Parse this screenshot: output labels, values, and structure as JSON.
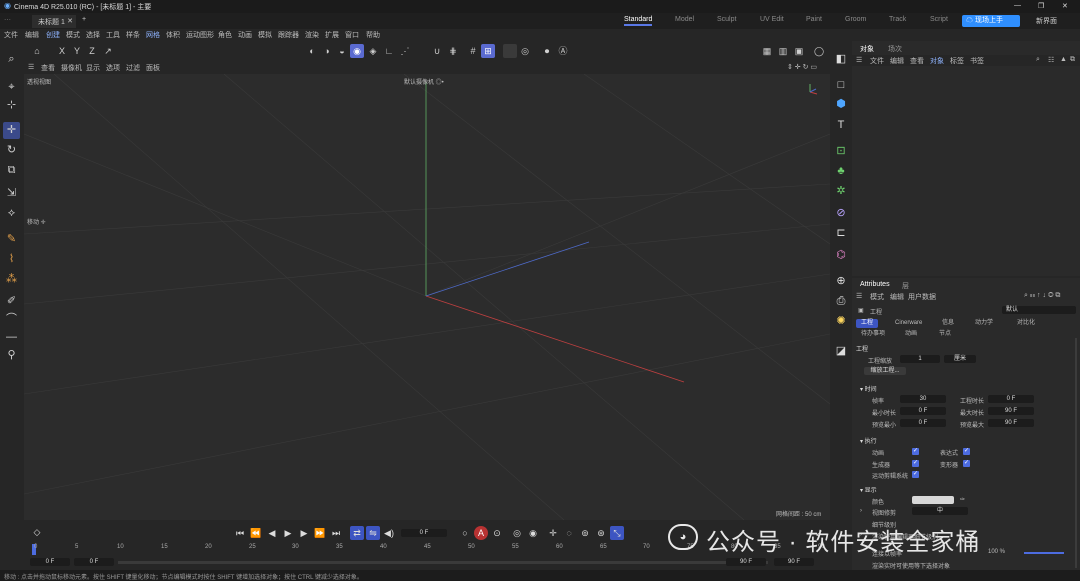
{
  "window": {
    "title": "Cinema 4D R25.010 (RC) - [未标题 1] - 主要",
    "controls": [
      "—",
      "❐",
      "✕"
    ]
  },
  "doc_tabs": {
    "active": "未标题 1",
    "new_tab": "+"
  },
  "layouts": [
    "Standard",
    "Model",
    "Sculpt",
    "UV Edit",
    "Paint",
    "Groom",
    "Track",
    "Script"
  ],
  "cloud_button": "现场上手",
  "new_interface": "新界面",
  "menu": [
    "文件",
    "编辑",
    "创建",
    "模式",
    "选择",
    "工具",
    "样条",
    "网格",
    "体积",
    "运动图形",
    "角色",
    "动画",
    "模拟",
    "跟踪器",
    "渲染",
    "扩展",
    "窗口",
    "帮助"
  ],
  "axis_buttons": [
    "X",
    "Y",
    "Z"
  ],
  "viewport": {
    "menu": [
      "查看",
      "摄像机",
      "显示",
      "选项",
      "过滤",
      "面板"
    ],
    "camera_label": "透视视图",
    "default_camera": "默认摄像机 ◎•",
    "move_label": "移动 ✛",
    "grid_label": "网格间距 : 50 cm"
  },
  "objects_panel": {
    "tabs": [
      "对象",
      "场次"
    ],
    "menu": [
      "文件",
      "编辑",
      "查看",
      "对象",
      "标签",
      "书签"
    ]
  },
  "attributes": {
    "title": "Attributes",
    "tab2": "层",
    "menu": [
      "模式",
      "编辑",
      "用户数据"
    ],
    "object": "工程",
    "preset": "默认",
    "section_tabs": [
      "工程",
      "Cinerware",
      "信息",
      "动力学",
      "对比化"
    ],
    "section_tabs2": [
      "待办事项",
      "动画",
      "节点"
    ],
    "section_title": "工程",
    "scale_label": "工程缩放",
    "scale_value": "1",
    "scale_unit": "厘米",
    "scale_button": "缩放工程...",
    "time_section": "▾ 时间",
    "fps_label": "帧率",
    "fps_value": "30",
    "project_time_label": "工程时长",
    "project_time_value": "0 F",
    "min_time_label": "最小时长",
    "min_time_value": "0 F",
    "max_time_label": "最大时长",
    "max_time_value": "90 F",
    "preview_min_label": "预览最小",
    "preview_min_value": "0 F",
    "preview_max_label": "预览最大",
    "preview_max_value": "90 F",
    "exec_section": "▾ 执行",
    "anim_label": "动画",
    "expr_label": "表达式",
    "gen_label": "生成器",
    "deform_label": "变形器",
    "motion_label": "运动剪辑系统",
    "display_section": "▾ 显示",
    "color_label": "颜色",
    "view_clip_label": "视图修剪",
    "view_clip_value": "中",
    "lod_label": "细节级别",
    "lod_value": "100 %",
    "render_lod_label": "渲染使用编辑器细节级别",
    "frame_rate_label": "连接以帧率",
    "note_label": "渲染实时可使用等下选择对象"
  },
  "timeline": {
    "current_frame": "0 F",
    "ruler": [
      "0",
      "5",
      "10",
      "15",
      "20",
      "25",
      "30",
      "35",
      "40",
      "45",
      "50",
      "55",
      "60",
      "65",
      "70",
      "75",
      "80",
      "85",
      "90"
    ],
    "start_field": "0 F",
    "start_field2": "0 F",
    "end_field": "90 F",
    "end_field2": "90 F"
  },
  "status": "移动 : 点击并拖动鼠标移动元素。按住 SHIFT 键量化移动；节点编辑模式时按住 SHIFT 键增加选择对象；按住 CTRL 键减少选择对象。",
  "watermark": "公众号 · 软件安装全家桶",
  "colors": {
    "accent": "#5a6ad0",
    "axis_x": "#c04040",
    "axis_y": "#5fae64",
    "axis_z": "#4e6ac8"
  }
}
